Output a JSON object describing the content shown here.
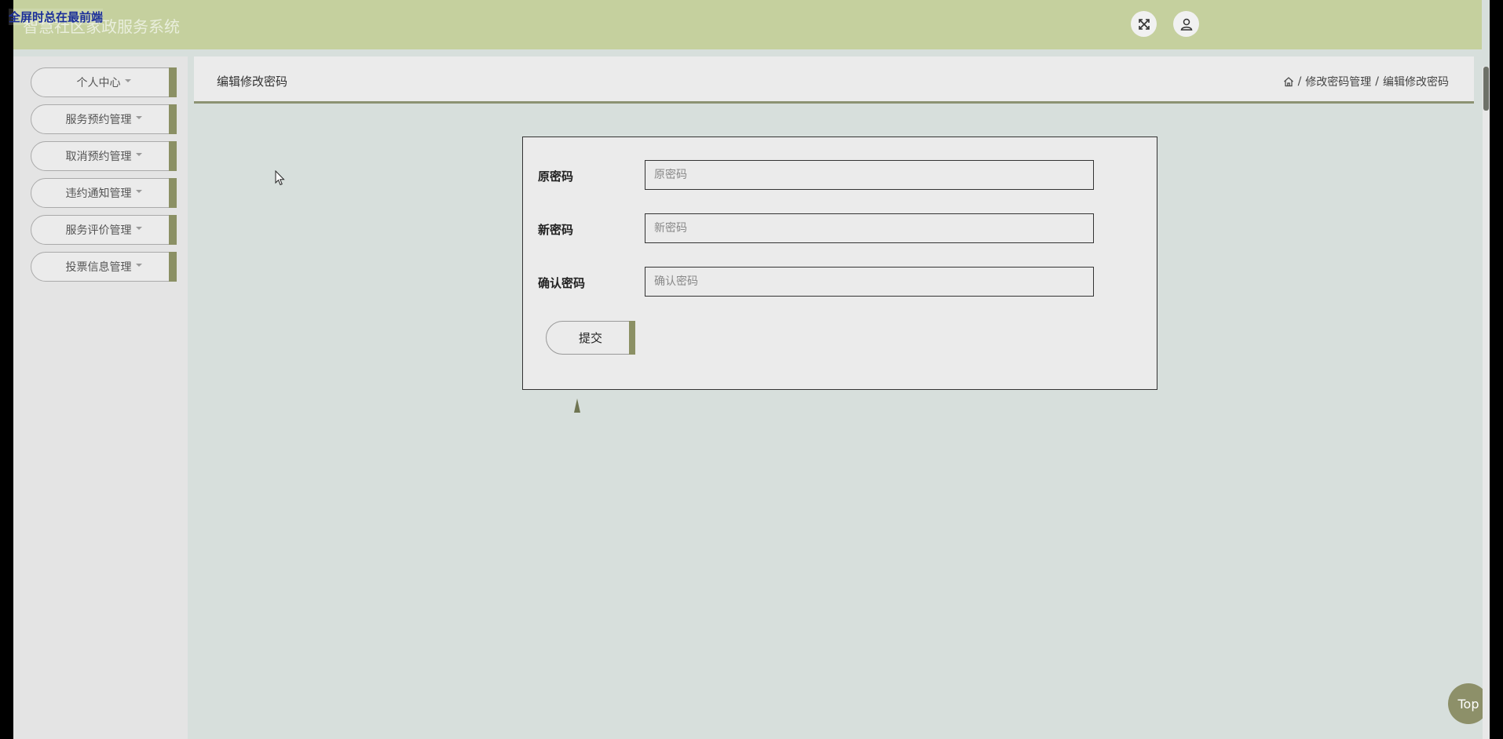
{
  "overlay": {
    "label": "全屏时总在最前端"
  },
  "header": {
    "site_title": "智慧社区家政服务系统",
    "icons": [
      "fullscreen-icon",
      "user-icon"
    ]
  },
  "sidebar": {
    "items": [
      {
        "label": "个人中心"
      },
      {
        "label": "服务预约管理"
      },
      {
        "label": "取消预约管理"
      },
      {
        "label": "违约通知管理"
      },
      {
        "label": "服务评价管理"
      },
      {
        "label": "投票信息管理"
      }
    ]
  },
  "page": {
    "title": "编辑修改密码",
    "breadcrumb": [
      "修改密码管理",
      "编辑修改密码"
    ],
    "breadcrumb_sep": "/"
  },
  "form": {
    "old_password": {
      "label": "原密码",
      "placeholder": "原密码",
      "value": ""
    },
    "new_password": {
      "label": "新密码",
      "placeholder": "新密码",
      "value": ""
    },
    "confirm_password": {
      "label": "确认密码",
      "placeholder": "确认密码",
      "value": ""
    },
    "submit_label": "提交"
  },
  "back_to_top": {
    "label": "Top"
  },
  "colors": {
    "header_bg": "#c5d09e",
    "accent": "#8b9064",
    "content_bg": "#d7dfdc"
  }
}
